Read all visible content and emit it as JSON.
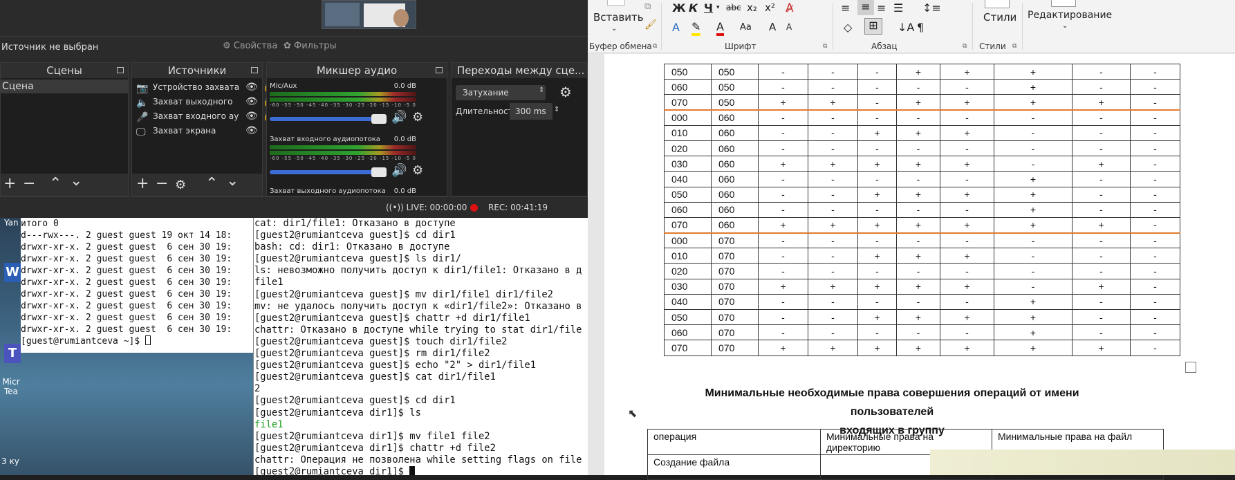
{
  "obs": {
    "no_source": "Источник не выбран",
    "properties_btn": "Свойства",
    "filters_btn": "Фильтры",
    "docks": {
      "scenes": "Сцены",
      "sources": "Источники",
      "mixer": "Микшер аудио",
      "transitions": "Переходы между сце..."
    },
    "scenes": [
      "Сцена"
    ],
    "sources": [
      {
        "label": "Устройство захвата",
        "icon": "camera-icon"
      },
      {
        "label": "Захват выходного",
        "icon": "speaker-icon"
      },
      {
        "label": "Захват входного ау",
        "icon": "mic-icon"
      },
      {
        "label": "Захват экрана",
        "icon": "monitor-icon"
      }
    ],
    "mixer": [
      {
        "name": "Mic/Aux",
        "db": "0.0 dB",
        "volume": 0.95
      },
      {
        "name": "Захват входного аудиопотока",
        "db": "0.0 dB",
        "volume": 0.95
      },
      {
        "name": "Захват выходного аудиопотока",
        "db": "0.0 dB"
      }
    ],
    "meter_ticks": "-60 -55 -50 -45 -40 -35 -30 -25 -20 -15 -10 -5 0",
    "transition": "Затухание",
    "duration_label": "Длительность",
    "duration_value": "300 ms",
    "live": "LIVE: 00:00:00",
    "rec": "REC: 00:41:19"
  },
  "term1": {
    "lines": [
      "итого 0",
      "d---rwx---. 2 guest guest 19 окт 14 18:",
      "drwxr-xr-x. 2 guest guest  6 сен 30 19:",
      "drwxr-xr-x. 2 guest guest  6 сен 30 19:",
      "drwxr-xr-x. 2 guest guest  6 сен 30 19:",
      "drwxr-xr-x. 2 guest guest  6 сен 30 19:",
      "drwxr-xr-x. 2 guest guest  6 сен 30 19:",
      "drwxr-xr-x. 2 guest guest  6 сен 30 19:",
      "drwxr-xr-x. 2 guest guest  6 сен 30 19:",
      "drwxr-xr-x. 2 guest guest  6 сен 30 19:"
    ],
    "prompt": "[guest@rumiantceva ~]$ "
  },
  "term2": {
    "lines": [
      "cat: dir1/file1: Отказано в доступе",
      "[guest2@rumiantceva guest]$ cd dir1",
      "bash: cd: dir1: Отказано в доступе",
      "[guest2@rumiantceva guest]$ ls dir1/",
      "ls: невозможно получить доступ к dir1/file1: Отказано в д",
      "file1",
      "[guest2@rumiantceva guest]$ mv dir1/file1 dir1/file2",
      "mv: не удалось получить доступ к «dir1/file2»: Отказано в",
      "[guest2@rumiantceva guest]$ chattr +d dir1/file1",
      "chattr: Отказано в доступе while trying to stat dir1/file",
      "[guest2@rumiantceva guest]$ touch dir1/file2",
      "[guest2@rumiantceva guest]$ rm dir1/file2",
      "[guest2@rumiantceva guest]$ echo \"2\" > dir1/file1",
      "[guest2@rumiantceva guest]$ cat dir1/file1",
      "2",
      "[guest2@rumiantceva guest]$ cd dir1",
      "[guest2@rumiantceva dir1]$ ls",
      "file1",
      "[guest2@rumiantceva dir1]$ mv file1 file2",
      "[guest2@rumiantceva dir1]$ chattr +d file2",
      "chattr: Операция не позволена while setting flags on file"
    ],
    "prompt": "[guest2@rumiantceva dir1]$ "
  },
  "desktop": {
    "icons": [
      "Yan",
      "W",
      "Micr Tea",
      "3 ку"
    ]
  },
  "word": {
    "paste": "Вставить",
    "clipboard": "Буфер обмена",
    "font": "Шрифт",
    "paragraph": "Абзац",
    "styles_btn": "Стили",
    "styles": "Стили",
    "editing": "Редактирование",
    "heading_line1": "Минимальные необходимые права совершения операций от имени пользователей",
    "heading_line2": "входящих в группу",
    "ops_headers": [
      "операция",
      "Минимальные права на директорию",
      "Минимальные права на файл"
    ],
    "ops_first_row": "Создание файла",
    "rows": [
      [
        "050",
        "050",
        "-",
        "-",
        "-",
        "+",
        "+",
        "+",
        "-",
        "-"
      ],
      [
        "060",
        "050",
        "-",
        "-",
        "-",
        "-",
        "-",
        "+",
        "-",
        "-"
      ],
      [
        "070",
        "050",
        "+",
        "+",
        "-",
        "+",
        "+",
        "+",
        "+",
        "-"
      ],
      [
        "000",
        "060",
        "-",
        "-",
        "-",
        "-",
        "-",
        "-",
        "-",
        "-"
      ],
      [
        "010",
        "060",
        "-",
        "-",
        "+",
        "+",
        "+",
        "-",
        "-",
        "-"
      ],
      [
        "020",
        "060",
        "-",
        "-",
        "-",
        "-",
        "-",
        "-",
        "-",
        "-"
      ],
      [
        "030",
        "060",
        "+",
        "+",
        "+",
        "+",
        "+",
        "-",
        "+",
        "-"
      ],
      [
        "040",
        "060",
        "-",
        "-",
        "-",
        "-",
        "-",
        "+",
        "-",
        "-"
      ],
      [
        "050",
        "060",
        "-",
        "-",
        "+",
        "+",
        "+",
        "+",
        "-",
        "-"
      ],
      [
        "060",
        "060",
        "-",
        "-",
        "-",
        "-",
        "-",
        "+",
        "-",
        "-"
      ],
      [
        "070",
        "060",
        "+",
        "+",
        "+",
        "+",
        "+",
        "+",
        "+",
        "-"
      ],
      [
        "000",
        "070",
        "-",
        "-",
        "-",
        "-",
        "-",
        "-",
        "-",
        "-"
      ],
      [
        "010",
        "070",
        "-",
        "-",
        "+",
        "+",
        "+",
        "-",
        "-",
        "-"
      ],
      [
        "020",
        "070",
        "-",
        "-",
        "-",
        "-",
        "-",
        "-",
        "-",
        "-"
      ],
      [
        "030",
        "070",
        "+",
        "+",
        "+",
        "+",
        "+",
        "-",
        "+",
        "-"
      ],
      [
        "040",
        "070",
        "-",
        "-",
        "-",
        "-",
        "-",
        "+",
        "-",
        "-"
      ],
      [
        "050",
        "070",
        "-",
        "-",
        "+",
        "+",
        "+",
        "+",
        "-",
        "-"
      ],
      [
        "060",
        "070",
        "-",
        "-",
        "-",
        "-",
        "-",
        "+",
        "-",
        "-"
      ],
      [
        "070",
        "070",
        "+",
        "+",
        "+",
        "+",
        "+",
        "+",
        "+",
        "-"
      ]
    ],
    "orange_after_rows": [
      2,
      10
    ]
  },
  "colors": {
    "obs_bg": "#2b2b2b",
    "rec_red": "#dd1111",
    "orange_rule": "#e07b2f",
    "term_green": "#1b9e1b"
  }
}
